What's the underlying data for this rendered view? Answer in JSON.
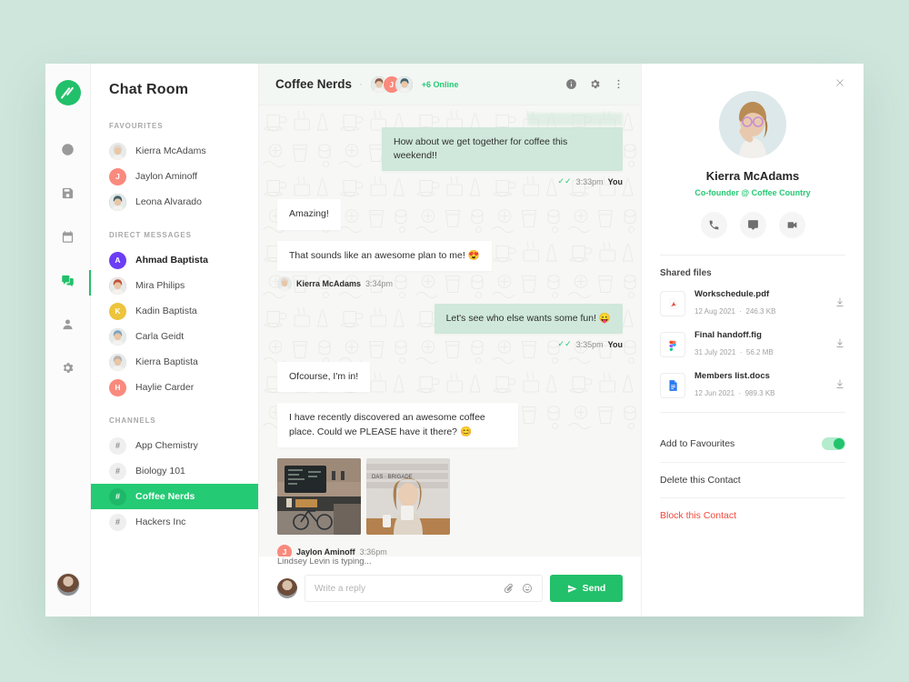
{
  "window": {
    "title": "Chat Room"
  },
  "rail": {
    "logo": "app-logo",
    "items": [
      {
        "icon": "clock-icon",
        "name": "activity"
      },
      {
        "icon": "save-icon",
        "name": "saved"
      },
      {
        "icon": "calendar-icon",
        "name": "calendar"
      },
      {
        "icon": "chat-icon",
        "name": "chat",
        "active": true
      },
      {
        "icon": "user-icon",
        "name": "profile"
      },
      {
        "icon": "gear-icon",
        "name": "settings"
      }
    ]
  },
  "sidebar": {
    "title": "Chat Room",
    "groups": [
      {
        "label": "FAVOURITES",
        "items": [
          {
            "name": "Kierra McAdams",
            "avatar": "photo",
            "color": "#e3d6cd"
          },
          {
            "name": "Jaylon Aminoff",
            "avatar": "initial",
            "initial": "J",
            "color": "#f98a7d"
          },
          {
            "name": "Leona Alvarado",
            "avatar": "photo",
            "color": "#42626b"
          }
        ]
      },
      {
        "label": "DIRECT MESSAGES",
        "items": [
          {
            "name": "Ahmad Baptista",
            "avatar": "initial",
            "initial": "A",
            "color": "#6b3df5",
            "bold": true
          },
          {
            "name": "Mira Philips",
            "avatar": "photo",
            "color": "#c0523a"
          },
          {
            "name": "Kadin Baptista",
            "avatar": "initial",
            "initial": "K",
            "color": "#edc43c"
          },
          {
            "name": "Carla Geidt",
            "avatar": "photo",
            "color": "#7fa3bd"
          },
          {
            "name": "Kierra Baptista",
            "avatar": "photo",
            "color": "#b9b0ab"
          },
          {
            "name": "Haylie Carder",
            "avatar": "initial",
            "initial": "H",
            "color": "#f98a7d"
          }
        ]
      },
      {
        "label": "CHANNELS",
        "items": [
          {
            "name": "App Chemistry",
            "avatar": "hash"
          },
          {
            "name": "Biology 101",
            "avatar": "hash"
          },
          {
            "name": "Coffee Nerds",
            "avatar": "hash",
            "selected": true
          },
          {
            "name": "Hackers Inc",
            "avatar": "hash"
          }
        ]
      }
    ]
  },
  "chat": {
    "room_name": "Coffee Nerds",
    "separator": "·",
    "online_text": "+6 Online",
    "header_avatars": [
      {
        "type": "photo",
        "color": "#8a5f4a"
      },
      {
        "type": "initial",
        "initial": "J",
        "color": "#f98a7d"
      },
      {
        "type": "photo",
        "color": "#3e6470"
      }
    ],
    "header_icons": [
      "info-icon",
      "gear-icon",
      "more-vertical-icon"
    ],
    "messages": [
      {
        "kind": "clipped",
        "side": "out"
      },
      {
        "kind": "text",
        "side": "out",
        "text": "How about we get together for coffee this weekend!!",
        "time": "3:33pm",
        "who": "You",
        "read": true
      },
      {
        "kind": "text",
        "side": "in",
        "text": "Amazing!"
      },
      {
        "kind": "text",
        "side": "in",
        "text": "That sounds like an awesome plan to me! 😍",
        "time": "3:34pm",
        "who": "Kierra McAdams",
        "avatar_color": "#e3d6cd"
      },
      {
        "kind": "text",
        "side": "out",
        "text": "Let's see who else wants some fun! 😛",
        "time": "3:35pm",
        "who": "You",
        "read": true
      },
      {
        "kind": "text",
        "side": "in",
        "text": "Ofcourse, I'm in!"
      },
      {
        "kind": "text",
        "side": "in",
        "text": "I have recently discovered an awesome coffee place. Could we PLEASE have it there? 😊"
      },
      {
        "kind": "photos",
        "side": "in",
        "photos": [
          "cafe-interior-photo",
          "woman-with-cup-photo"
        ],
        "time": "3:36pm",
        "who": "Jaylon Aminoff",
        "initial": "J",
        "avatar_color": "#f98a7d"
      }
    ],
    "typing_text": "Lindsey Levin is typing...",
    "composer": {
      "placeholder": "Write a reply",
      "value": "",
      "attach_icon": "paperclip-icon",
      "emoji_icon": "smiley-icon",
      "send_label": "Send",
      "send_icon": "send-icon"
    }
  },
  "panel": {
    "close_icon": "close-icon",
    "profile": {
      "avatar": "kierra-photo",
      "name": "Kierra McAdams",
      "role": "Co-founder @ Coffee Country"
    },
    "actions": [
      {
        "icon": "phone-icon",
        "name": "call"
      },
      {
        "icon": "message-icon",
        "name": "message"
      },
      {
        "icon": "video-icon",
        "name": "video-call"
      }
    ],
    "files_title": "Shared files",
    "files": [
      {
        "name": "Workschedule.pdf",
        "date": "12 Aug 2021",
        "size": "246.3 KB",
        "type": "pdf"
      },
      {
        "name": "Final handoff.fig",
        "date": "31 July 2021",
        "size": "56.2 MB",
        "type": "fig"
      },
      {
        "name": "Members list.docs",
        "date": "12 Jun 2021",
        "size": "989.3 KB",
        "type": "doc"
      }
    ],
    "file_sep": "·",
    "options": [
      {
        "label": "Add to Favourites",
        "toggle": true,
        "toggle_on": true
      },
      {
        "label": "Delete this Contact"
      },
      {
        "label": "Block this Contact",
        "danger": true
      }
    ]
  },
  "colors": {
    "accent_green": "#22c06a",
    "bubble_out": "#cfe8db",
    "page_bg": "#cfe6dd",
    "danger": "#f4483b"
  }
}
